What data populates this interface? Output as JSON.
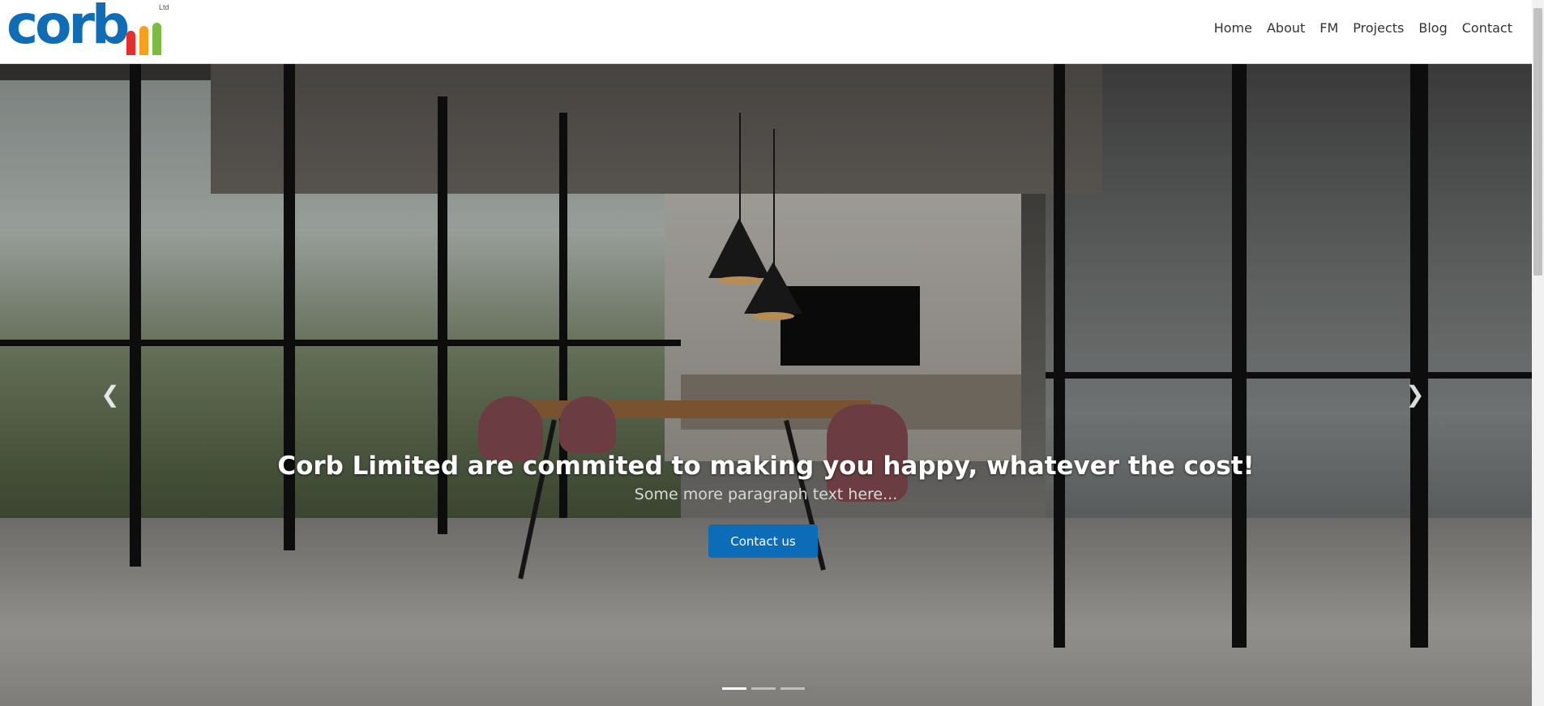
{
  "brand": {
    "name": "corb",
    "suffix": "Ltd",
    "colors": [
      "#e62e2d",
      "#f7a11a",
      "#7cbc42"
    ],
    "primary": "#0f6cb6"
  },
  "nav": {
    "items": [
      "Home",
      "About",
      "FM",
      "Projects",
      "Blog",
      "Contact"
    ]
  },
  "hero": {
    "heading": "Corb Limited are commited to making you happy, whatever the cost!",
    "subheading": "Some more paragraph text here...",
    "cta_label": "Contact us",
    "prev_icon": "chevron-left-icon",
    "next_icon": "chevron-right-icon",
    "slides": 3,
    "active_slide": 1
  }
}
